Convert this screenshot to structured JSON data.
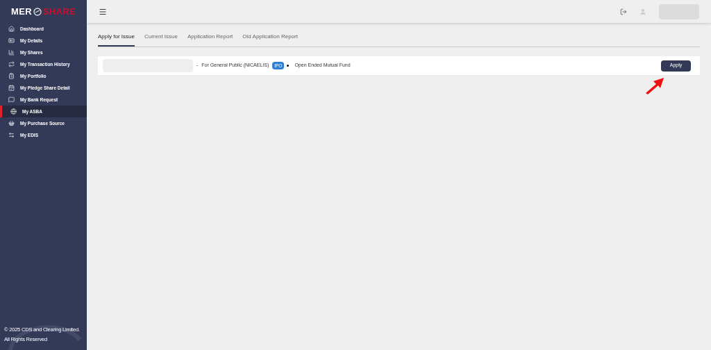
{
  "logo": {
    "left": "MER",
    "right": "SHARE"
  },
  "sidebar": {
    "items": [
      {
        "label": "Dashboard",
        "kind": "home",
        "selected": false
      },
      {
        "label": "My Details",
        "kind": "id",
        "selected": false
      },
      {
        "label": "My Shares",
        "kind": "chart",
        "selected": false
      },
      {
        "label": "My Transaction History",
        "kind": "transfer",
        "selected": false
      },
      {
        "label": "My Portfolio",
        "kind": "clipboard",
        "selected": false
      },
      {
        "label": "My Pledge Share Detail",
        "kind": "calendar",
        "selected": false
      },
      {
        "label": "My Bank Request",
        "kind": "message",
        "selected": false
      },
      {
        "label": "My ASBA",
        "kind": "globe",
        "selected": true
      },
      {
        "label": "My Purchase Source",
        "kind": "basket",
        "selected": false
      },
      {
        "label": "My EDIS",
        "kind": "arrows",
        "selected": false
      }
    ],
    "footer": [
      "© 2025 CDS and Clearing Limited.",
      "All Rights Reserved"
    ]
  },
  "tabs": [
    {
      "label": "Apply for Issue",
      "selected": true
    },
    {
      "label": "Current Issue",
      "selected": false
    },
    {
      "label": "Application Report",
      "selected": false
    },
    {
      "label": "Old Application Report",
      "selected": false
    }
  ],
  "issues": [
    {
      "separator": "-",
      "group": "For General Public (NICAELIS)",
      "badge": "IPO",
      "type": "Open Ended Mutual Fund",
      "button": "Apply"
    }
  ]
}
